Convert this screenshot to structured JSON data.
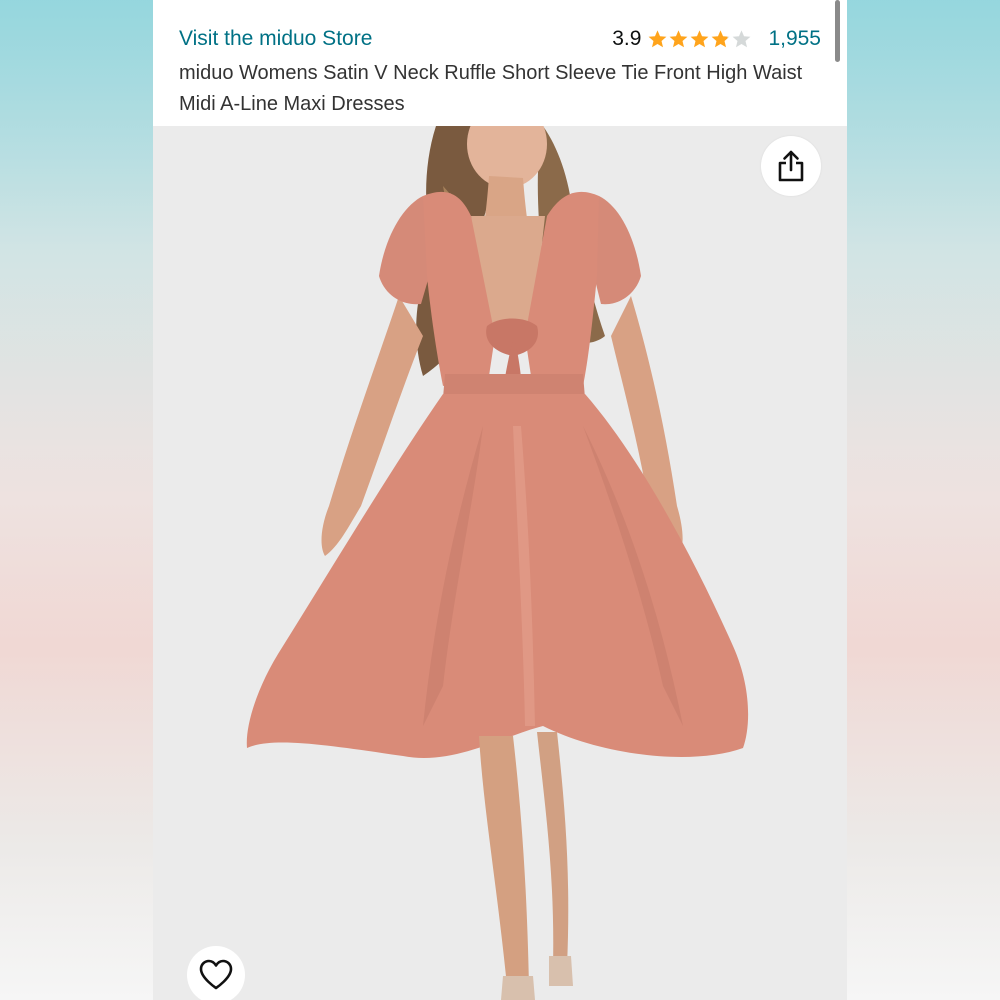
{
  "header": {
    "store_link": "Visit the miduo Store",
    "rating_value": "3.9",
    "rating_stars": 3.9,
    "rating_max": 5,
    "review_count": "1,955",
    "product_title": "miduo Womens Satin V Neck Ruffle Short Sleeve Tie Front High Waist Midi A-Line Maxi Dresses"
  },
  "image": {
    "alt": "Model wearing a pink satin tie-front midi dress"
  },
  "icons": {
    "share": "share-icon",
    "wishlist": "heart-icon",
    "star": "star-icon"
  },
  "colors": {
    "link": "#007185",
    "star_filled": "#FFA41C",
    "star_empty": "#D5D9D9",
    "dress": "#d98b78",
    "background": "#ebebeb"
  }
}
